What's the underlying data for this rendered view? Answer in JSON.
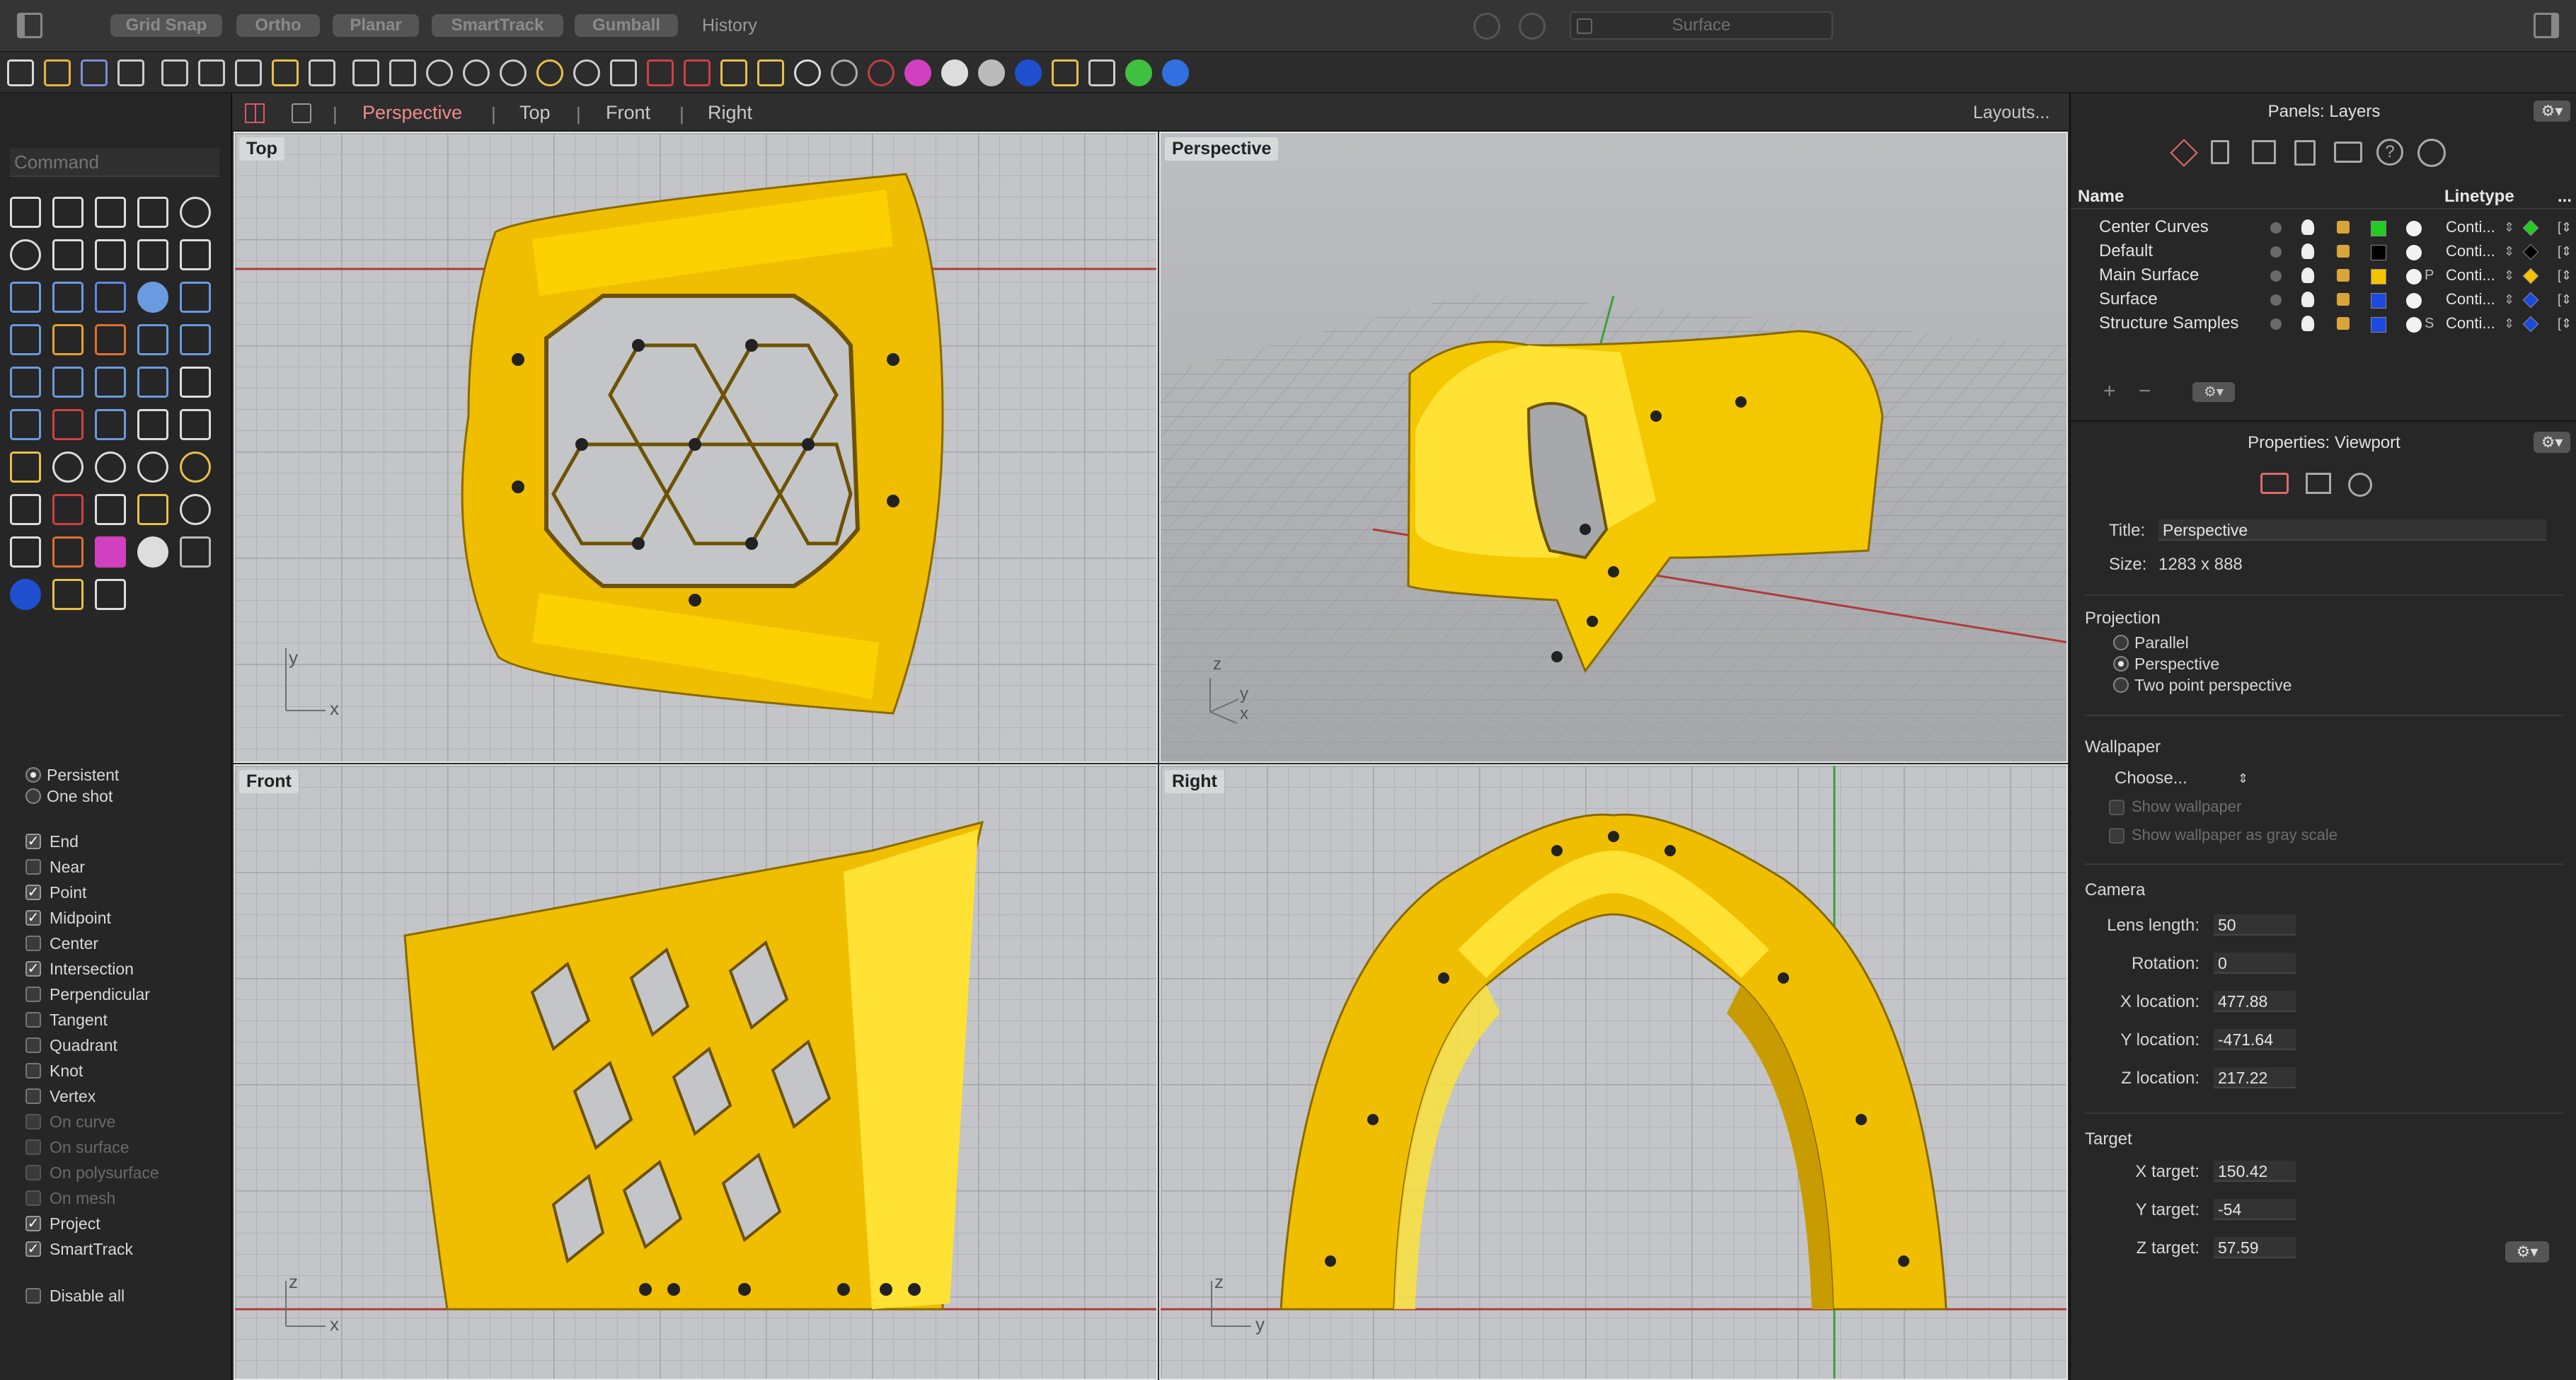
{
  "topbar": {
    "pills": [
      "Grid Snap",
      "Ortho",
      "Planar",
      "SmartTrack",
      "Gumball"
    ],
    "history": "History",
    "command_status": "Surface"
  },
  "command": {
    "placeholder": "Command"
  },
  "osnap": {
    "modes": [
      {
        "label": "Persistent",
        "selected": true
      },
      {
        "label": "One shot",
        "selected": false
      }
    ],
    "items": [
      {
        "label": "End",
        "checked": true,
        "enabled": true
      },
      {
        "label": "Near",
        "checked": false,
        "enabled": true
      },
      {
        "label": "Point",
        "checked": true,
        "enabled": true
      },
      {
        "label": "Midpoint",
        "checked": true,
        "enabled": true
      },
      {
        "label": "Center",
        "checked": false,
        "enabled": true
      },
      {
        "label": "Intersection",
        "checked": true,
        "enabled": true
      },
      {
        "label": "Perpendicular",
        "checked": false,
        "enabled": true
      },
      {
        "label": "Tangent",
        "checked": false,
        "enabled": true
      },
      {
        "label": "Quadrant",
        "checked": false,
        "enabled": true
      },
      {
        "label": "Knot",
        "checked": false,
        "enabled": true
      },
      {
        "label": "Vertex",
        "checked": false,
        "enabled": true
      },
      {
        "label": "On curve",
        "checked": false,
        "enabled": false
      },
      {
        "label": "On surface",
        "checked": false,
        "enabled": false
      },
      {
        "label": "On polysurface",
        "checked": false,
        "enabled": false
      },
      {
        "label": "On mesh",
        "checked": false,
        "enabled": false
      },
      {
        "label": "Project",
        "checked": true,
        "enabled": true
      },
      {
        "label": "SmartTrack",
        "checked": true,
        "enabled": true
      }
    ],
    "disable_all": "Disable all"
  },
  "viewport_tabs": {
    "tabs": [
      "Perspective",
      "Top",
      "Front",
      "Right"
    ],
    "active": "Perspective",
    "layouts": "Layouts..."
  },
  "viewports": {
    "top": {
      "label": "Top",
      "axis_a": "y",
      "axis_b": "x"
    },
    "perspective": {
      "label": "Perspective",
      "axis_a": "z",
      "axis_b": "y",
      "axis_c": "x"
    },
    "front": {
      "label": "Front",
      "axis_a": "z",
      "axis_b": "x"
    },
    "right": {
      "label": "Right",
      "axis_a": "z",
      "axis_b": "y"
    }
  },
  "layers_panel": {
    "title": "Panels: Layers",
    "col_name": "Name",
    "col_linetype": "Linetype",
    "col_more": "...",
    "layers": [
      {
        "name": "Center Curves",
        "color": "#22cc22",
        "linetype": "Conti...",
        "material": ""
      },
      {
        "name": "Default",
        "color": "#000000",
        "linetype": "Conti...",
        "material": ""
      },
      {
        "name": "Main Surface",
        "color": "#f5c400",
        "linetype": "Conti...",
        "material": "P"
      },
      {
        "name": "Surface",
        "color": "#1a4ae0",
        "linetype": "Conti...",
        "material": ""
      },
      {
        "name": "Structure Samples",
        "color": "#1a4ae0",
        "linetype": "Conti...",
        "material": "S"
      }
    ]
  },
  "properties": {
    "title": "Properties: Viewport",
    "title_label": "Title:",
    "title_value": "Perspective",
    "size_label": "Size:",
    "size_value": "1283 x 888",
    "projection_label": "Projection",
    "projections": [
      {
        "label": "Parallel",
        "selected": false
      },
      {
        "label": "Perspective",
        "selected": true
      },
      {
        "label": "Two point perspective",
        "selected": false
      }
    ],
    "wallpaper_label": "Wallpaper",
    "wallpaper_choose": "Choose...",
    "show_wallpaper": "Show wallpaper",
    "show_wallpaper_gray": "Show wallpaper as gray scale",
    "camera_label": "Camera",
    "camera": [
      {
        "label": "Lens length:",
        "value": "50"
      },
      {
        "label": "Rotation:",
        "value": "0"
      },
      {
        "label": "X location:",
        "value": "477.88"
      },
      {
        "label": "Y location:",
        "value": "-471.64"
      },
      {
        "label": "Z location:",
        "value": "217.22"
      }
    ],
    "target_label": "Target",
    "target": [
      {
        "label": "X target:",
        "value": "150.42"
      },
      {
        "label": "Y target:",
        "value": "-54"
      },
      {
        "label": "Z target:",
        "value": "57.59"
      }
    ]
  },
  "colors": {
    "accent_tab": "#f08a8a",
    "geometry": "#f2c200",
    "geometry_light": "#ffe233",
    "geometry_dark": "#c29200",
    "axis_x": "#b03a3a",
    "axis_y": "#3aa03a"
  }
}
